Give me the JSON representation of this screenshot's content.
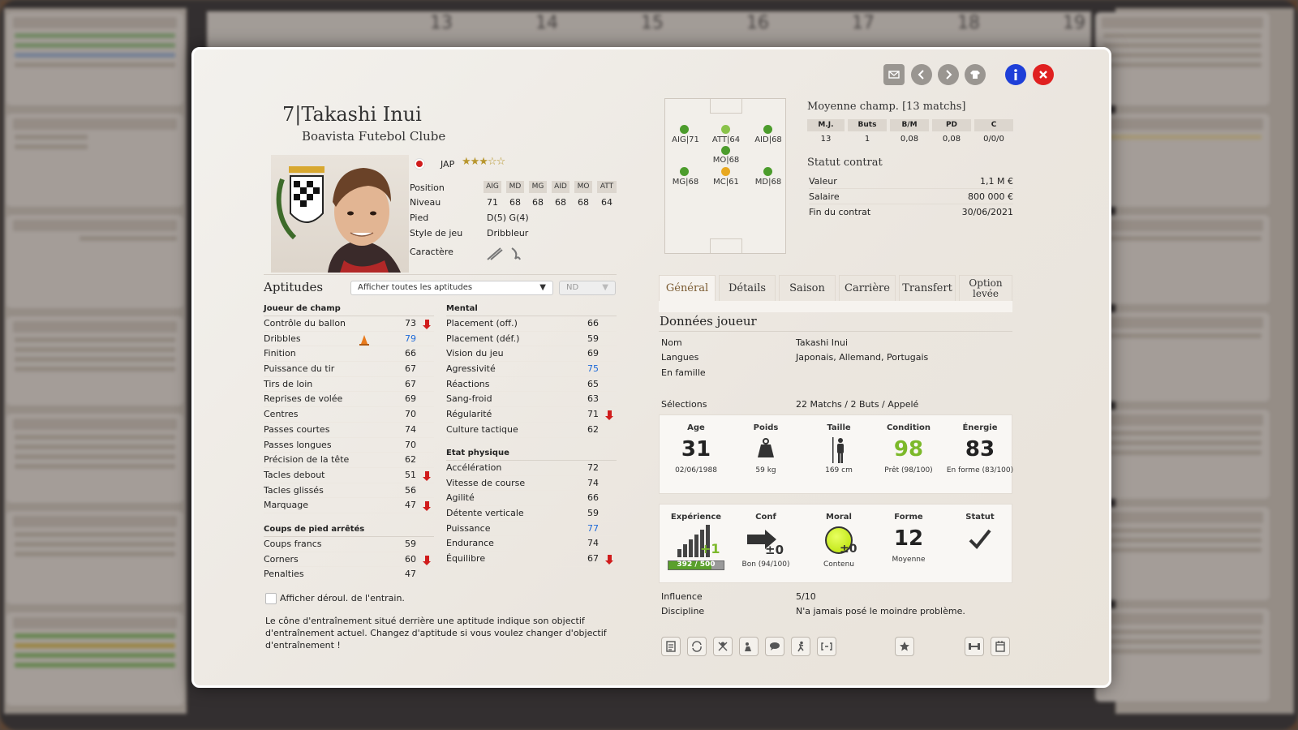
{
  "player": {
    "number": "7|",
    "name": "Takashi Inui",
    "club": "Boavista Futebol Clube",
    "nationality": "JAP",
    "stars": "★★★☆☆"
  },
  "position_table": {
    "row_labels": {
      "position": "Position",
      "level": "Niveau",
      "foot": "Pied",
      "style": "Style de jeu",
      "character": "Caractère"
    },
    "headers": [
      "AIG",
      "MD",
      "MG",
      "AID",
      "MO",
      "ATT"
    ],
    "levels": [
      "71",
      "68",
      "68",
      "68",
      "68",
      "64"
    ],
    "foot": "D(5) G(4)",
    "style": "Dribbleur"
  },
  "aptitudes": {
    "title": "Aptitudes",
    "filter": "Afficher toutes les aptitudes",
    "nd": "ND",
    "outfield": {
      "title": "Joueur de champ",
      "rows": [
        {
          "name": "Contrôle du ballon",
          "value": "73"
        },
        {
          "name": "Dribbles",
          "value": "79"
        },
        {
          "name": "Finition",
          "value": "66"
        },
        {
          "name": "Puissance du tir",
          "value": "67"
        },
        {
          "name": "Tirs de loin",
          "value": "67"
        },
        {
          "name": "Reprises de volée",
          "value": "69"
        },
        {
          "name": "Centres",
          "value": "70"
        },
        {
          "name": "Passes courtes",
          "value": "74"
        },
        {
          "name": "Passes longues",
          "value": "70"
        },
        {
          "name": "Précision de la tête",
          "value": "62"
        },
        {
          "name": "Tacles debout",
          "value": "51"
        },
        {
          "name": "Tacles glissés",
          "value": "56"
        },
        {
          "name": "Marquage",
          "value": "47"
        }
      ]
    },
    "set_pieces": {
      "title": "Coups de pied arrêtés",
      "rows": [
        {
          "name": "Coups francs",
          "value": "59"
        },
        {
          "name": "Corners",
          "value": "60"
        },
        {
          "name": "Penalties",
          "value": "47"
        }
      ]
    },
    "mental": {
      "title": "Mental",
      "rows": [
        {
          "name": "Placement (off.)",
          "value": "66"
        },
        {
          "name": "Placement (déf.)",
          "value": "59"
        },
        {
          "name": "Vision du jeu",
          "value": "69"
        },
        {
          "name": "Agressivité",
          "value": "75"
        },
        {
          "name": "Réactions",
          "value": "65"
        },
        {
          "name": "Sang-froid",
          "value": "63"
        },
        {
          "name": "Régularité",
          "value": "71"
        },
        {
          "name": "Culture tactique",
          "value": "62"
        }
      ]
    },
    "physical": {
      "title": "Etat physique",
      "rows": [
        {
          "name": "Accélération",
          "value": "72"
        },
        {
          "name": "Vitesse de course",
          "value": "74"
        },
        {
          "name": "Agilité",
          "value": "66"
        },
        {
          "name": "Détente verticale",
          "value": "59"
        },
        {
          "name": "Puissance",
          "value": "77"
        },
        {
          "name": "Endurance",
          "value": "74"
        },
        {
          "name": "Équilibre",
          "value": "67"
        }
      ]
    },
    "checkbox_label": "Afficher déroul. de l'entrain.",
    "help_text": "Le cône d'entraînement situé derrière une aptitude indique son objectif d'entraînement actuel. Changez d'aptitude si vous voulez changer d'objectif d'entraînement !"
  },
  "pitch": {
    "positions": [
      "AIG|71",
      "ATT|64",
      "AID|68",
      "MO|68",
      "MG|68",
      "MC|61",
      "MD|68"
    ]
  },
  "league_avg": {
    "title": "Moyenne champ. [13 matchs]",
    "headers": [
      "M.J.",
      "Buts",
      "B/M",
      "PD",
      "C"
    ],
    "values": [
      "13",
      "1",
      "0,08",
      "0,08",
      "0/0/0"
    ]
  },
  "contract": {
    "title": "Statut contrat",
    "rows": [
      {
        "k": "Valeur",
        "v": "1,1 M €"
      },
      {
        "k": "Salaire",
        "v": "800 000 €"
      },
      {
        "k": "Fin du contrat",
        "v": "30/06/2021"
      }
    ]
  },
  "tabs": [
    "Général",
    "Détails",
    "Saison",
    "Carrière",
    "Transfert",
    "Option levée"
  ],
  "player_data": {
    "title": "Données joueur",
    "rows": [
      {
        "k": "Nom",
        "v": "Takashi Inui"
      },
      {
        "k": "Langues",
        "v": "Japonais, Allemand, Portugais"
      },
      {
        "k": "En famille",
        "v": ""
      },
      {
        "k": "Sélections",
        "v": "22 Matchs / 2 Buts / Appelé"
      }
    ]
  },
  "box1": {
    "age": {
      "label": "Age",
      "big": "31",
      "small": "02/06/1988"
    },
    "weight": {
      "label": "Poids",
      "small": "59 kg"
    },
    "height": {
      "label": "Taille",
      "small": "169 cm"
    },
    "condition": {
      "label": "Condition",
      "big": "98",
      "small": "Prêt (98/100)"
    },
    "energy": {
      "label": "Énergie",
      "big": "83",
      "small": "En forme (83/100)"
    }
  },
  "box2": {
    "experience": {
      "label": "Expérience",
      "bar": "392 / 500",
      "progress": 0.784,
      "badge": "+1"
    },
    "conf": {
      "label": "Conf",
      "badge": "±0",
      "small": "Bon (94/100)"
    },
    "morale": {
      "label": "Moral",
      "badge": "±0",
      "small": "Contenu"
    },
    "form": {
      "label": "Forme",
      "big": "12",
      "small": "Moyenne"
    },
    "status": {
      "label": "Statut"
    }
  },
  "extra": {
    "rows": [
      {
        "k": "Influence",
        "v": "5/10"
      },
      {
        "k": "Discipline",
        "v": "N'a jamais posé le moindre problème."
      }
    ]
  },
  "colors": {
    "green": "#7cb92a",
    "red": "#d01c1c",
    "blue": "#1e3fd8",
    "link_blue": "#1e6ad8"
  }
}
